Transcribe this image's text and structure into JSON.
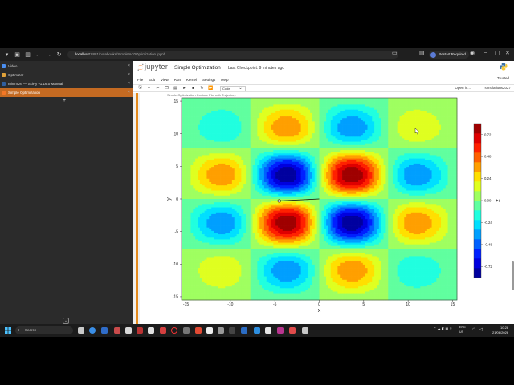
{
  "browser": {
    "url_host": "localhost",
    "url_path": ":8881/notebooks/Simple%20Optimization.ipynb",
    "profile_label": "Restart Required"
  },
  "tabs": [
    {
      "label": "Video",
      "active": false,
      "color": "#4a8ef0"
    },
    {
      "label": "Optimizer",
      "active": false,
      "color": "#e0a23a"
    },
    {
      "label": "minimize — SciPy v1.16.0 Manual",
      "active": false,
      "color": "#2f5fa0"
    },
    {
      "label": "Simple Optimization",
      "active": true,
      "color": "#f37726"
    }
  ],
  "notebook": {
    "logo": "jupyter",
    "title": "Simple Optimization",
    "checkpoint": "Last Checkpoint: 9 minutes ago",
    "trusted": "Trusted",
    "menu": [
      "File",
      "Edit",
      "View",
      "Run",
      "Kernel",
      "Settings",
      "Help"
    ],
    "cell_type": "Code",
    "open_in": "Open in...",
    "kernel": "simulations2027",
    "output_caption": "Simple Optimization Contour Plot with Trajectory"
  },
  "chart_data": {
    "type": "contour",
    "title": "",
    "xlabel": "x",
    "ylabel": "y",
    "colorbar_label": "z",
    "xlim": [
      -15.5,
      15.5
    ],
    "ylim": [
      -15.5,
      15.5
    ],
    "xticks": [
      -15,
      -10,
      -5,
      0,
      5,
      10,
      15
    ],
    "yticks": [
      -15,
      -10,
      -5,
      0,
      5,
      10,
      15
    ],
    "colorbar_ticks": [
      -0.72,
      -0.48,
      -0.24,
      0.0,
      0.24,
      0.48,
      0.72
    ],
    "colorbar_range": [
      -0.84,
      0.84
    ],
    "colormap": "jet",
    "function": "z = sin(x/2.5)·sin(y/2.5)·exp(-(x²+y²)/160)",
    "extrema": [
      {
        "x": -4,
        "y": 0,
        "z": -0.84,
        "kind": "min"
      },
      {
        "x": 4,
        "y": 0,
        "z": 0.84,
        "kind": "max"
      }
    ],
    "trajectory": {
      "x": [
        0,
        -4.5
      ],
      "y": [
        0,
        -0.3
      ]
    },
    "marker": {
      "x": -4.5,
      "y": -0.3
    }
  },
  "status": {
    "zoom_label": "Reset",
    "zoom_value": "120 %"
  },
  "taskbar": {
    "search": "Search",
    "lang_line1": "ENG",
    "lang_line2": "US",
    "time": "10:28",
    "date": "21/06/2026"
  }
}
